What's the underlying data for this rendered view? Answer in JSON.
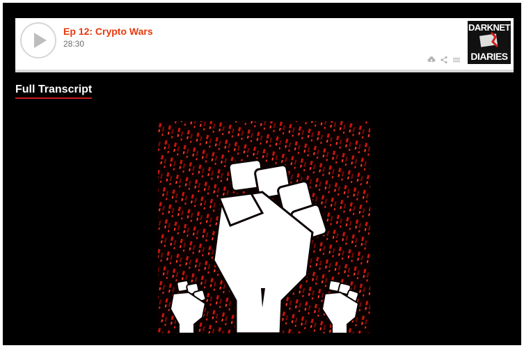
{
  "player": {
    "episode_title": "Ep 12: Crypto Wars",
    "duration": "28:30",
    "logo_top": "DARKNET",
    "logo_bottom": "DIARIES",
    "action_icons": [
      "download-icon",
      "share-icon",
      "playlist-icon"
    ]
  },
  "content": {
    "transcript_link": "Full Transcript"
  },
  "colors": {
    "background": "#000000",
    "accent": "#e8380d",
    "underline": "#d11a1a",
    "artwork_red": "#c4160c"
  }
}
